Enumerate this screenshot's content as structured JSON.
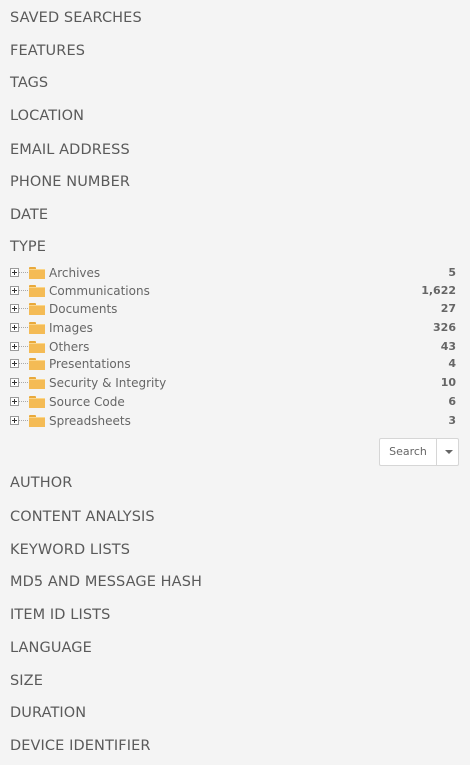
{
  "sections_top": [
    "SAVED SEARCHES",
    "FEATURES",
    "TAGS",
    "LOCATION",
    "EMAIL ADDRESS",
    "PHONE NUMBER",
    "DATE",
    "TYPE"
  ],
  "type_tree": [
    {
      "label": "Archives",
      "count": "5",
      "icon": "folder-icon"
    },
    {
      "label": "Communications",
      "count": "1,622",
      "icon": "folder-icon"
    },
    {
      "label": "Documents",
      "count": "27",
      "icon": "folder-icon"
    },
    {
      "label": "Images",
      "count": "326",
      "icon": "folder-icon"
    },
    {
      "label": "Others",
      "count": "43",
      "icon": "folder-icon"
    },
    {
      "label": "Presentations",
      "count": "4",
      "icon": "folder-icon"
    },
    {
      "label": "Security & Integrity",
      "count": "10",
      "icon": "folder-icon"
    },
    {
      "label": "Source Code",
      "count": "6",
      "icon": "folder-icon"
    },
    {
      "label": "Spreadsheets",
      "count": "3",
      "icon": "folder-icon"
    }
  ],
  "search_button": {
    "label": "Search",
    "dropdown_icon": "chevron-down-icon"
  },
  "sections_bottom": [
    "AUTHOR",
    "CONTENT ANALYSIS",
    "KEYWORD LISTS",
    "MD5 AND MESSAGE HASH",
    "ITEM ID LISTS",
    "LANGUAGE",
    "SIZE",
    "DURATION",
    "DEVICE IDENTIFIER"
  ],
  "colors": {
    "background": "#f4f4f4",
    "folder": "#f4bb55",
    "text": "#5a5a5a"
  }
}
